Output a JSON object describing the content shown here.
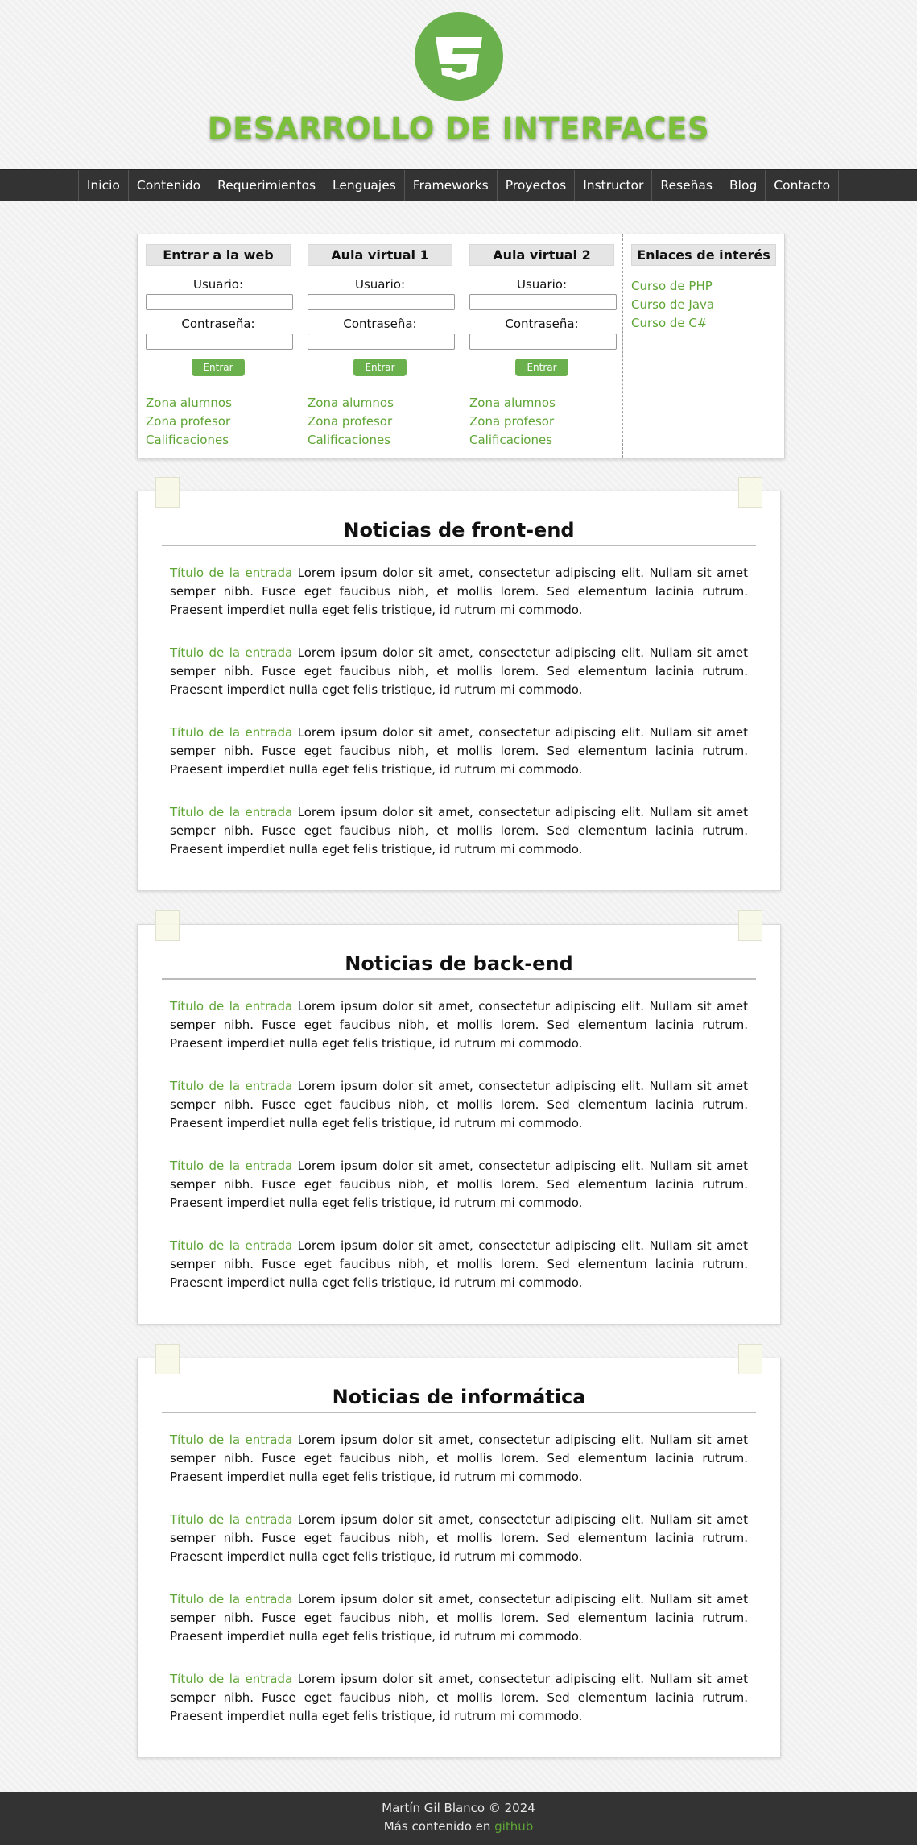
{
  "header": {
    "logo_icon": "css3-shield-icon",
    "title": "DESARROLLO DE INTERFACES",
    "accent_color": "#6ab04c"
  },
  "nav": {
    "items": [
      {
        "label": "Inicio"
      },
      {
        "label": "Contenido"
      },
      {
        "label": "Requerimientos"
      },
      {
        "label": "Lenguajes"
      },
      {
        "label": "Frameworks"
      },
      {
        "label": "Proyectos"
      },
      {
        "label": "Instructor"
      },
      {
        "label": "Reseñas"
      },
      {
        "label": "Blog"
      },
      {
        "label": "Contacto"
      }
    ]
  },
  "login": {
    "columns": [
      {
        "title": "Entrar a la web",
        "user_label": "Usuario:",
        "pass_label": "Contraseña:",
        "button": "Entrar",
        "links": [
          "Zona alumnos",
          "Zona profesor",
          "Calificaciones"
        ]
      },
      {
        "title": "Aula virtual 1",
        "user_label": "Usuario:",
        "pass_label": "Contraseña:",
        "button": "Entrar",
        "links": [
          "Zona alumnos",
          "Zona profesor",
          "Calificaciones"
        ]
      },
      {
        "title": "Aula virtual 2",
        "user_label": "Usuario:",
        "pass_label": "Contraseña:",
        "button": "Entrar",
        "links": [
          "Zona alumnos",
          "Zona profesor",
          "Calificaciones"
        ]
      }
    ],
    "interest": {
      "title": "Enlaces de interés",
      "links": [
        "Curso de PHP",
        "Curso de Java",
        "Curso de C#"
      ]
    }
  },
  "news": [
    {
      "title": "Noticias de front-end",
      "entries": [
        {
          "link": "Título de la entrada",
          "text": " Lorem ipsum dolor sit amet, consectetur adipiscing elit. Nullam sit amet semper nibh. Fusce eget faucibus nibh, et mollis lorem. Sed elementum lacinia rutrum. Praesent imperdiet nulla eget felis tristique, id rutrum mi commodo."
        },
        {
          "link": "Título de la entrada",
          "text": " Lorem ipsum dolor sit amet, consectetur adipiscing elit. Nullam sit amet semper nibh. Fusce eget faucibus nibh, et mollis lorem. Sed elementum lacinia rutrum. Praesent imperdiet nulla eget felis tristique, id rutrum mi commodo."
        },
        {
          "link": "Título de la entrada",
          "text": " Lorem ipsum dolor sit amet, consectetur adipiscing elit. Nullam sit amet semper nibh. Fusce eget faucibus nibh, et mollis lorem. Sed elementum lacinia rutrum. Praesent imperdiet nulla eget felis tristique, id rutrum mi commodo."
        },
        {
          "link": "Título de la entrada",
          "text": " Lorem ipsum dolor sit amet, consectetur adipiscing elit. Nullam sit amet semper nibh. Fusce eget faucibus nibh, et mollis lorem. Sed elementum lacinia rutrum. Praesent imperdiet nulla eget felis tristique, id rutrum mi commodo."
        }
      ]
    },
    {
      "title": "Noticias de back-end",
      "entries": [
        {
          "link": "Título de la entrada",
          "text": " Lorem ipsum dolor sit amet, consectetur adipiscing elit. Nullam sit amet semper nibh. Fusce eget faucibus nibh, et mollis lorem. Sed elementum lacinia rutrum. Praesent imperdiet nulla eget felis tristique, id rutrum mi commodo."
        },
        {
          "link": "Título de la entrada",
          "text": " Lorem ipsum dolor sit amet, consectetur adipiscing elit. Nullam sit amet semper nibh. Fusce eget faucibus nibh, et mollis lorem. Sed elementum lacinia rutrum. Praesent imperdiet nulla eget felis tristique, id rutrum mi commodo."
        },
        {
          "link": "Título de la entrada",
          "text": " Lorem ipsum dolor sit amet, consectetur adipiscing elit. Nullam sit amet semper nibh. Fusce eget faucibus nibh, et mollis lorem. Sed elementum lacinia rutrum. Praesent imperdiet nulla eget felis tristique, id rutrum mi commodo."
        },
        {
          "link": "Título de la entrada",
          "text": " Lorem ipsum dolor sit amet, consectetur adipiscing elit. Nullam sit amet semper nibh. Fusce eget faucibus nibh, et mollis lorem. Sed elementum lacinia rutrum. Praesent imperdiet nulla eget felis tristique, id rutrum mi commodo."
        }
      ]
    },
    {
      "title": "Noticias de informática",
      "entries": [
        {
          "link": "Título de la entrada",
          "text": " Lorem ipsum dolor sit amet, consectetur adipiscing elit. Nullam sit amet semper nibh. Fusce eget faucibus nibh, et mollis lorem. Sed elementum lacinia rutrum. Praesent imperdiet nulla eget felis tristique, id rutrum mi commodo."
        },
        {
          "link": "Título de la entrada",
          "text": " Lorem ipsum dolor sit amet, consectetur adipiscing elit. Nullam sit amet semper nibh. Fusce eget faucibus nibh, et mollis lorem. Sed elementum lacinia rutrum. Praesent imperdiet nulla eget felis tristique, id rutrum mi commodo."
        },
        {
          "link": "Título de la entrada",
          "text": " Lorem ipsum dolor sit amet, consectetur adipiscing elit. Nullam sit amet semper nibh. Fusce eget faucibus nibh, et mollis lorem. Sed elementum lacinia rutrum. Praesent imperdiet nulla eget felis tristique, id rutrum mi commodo."
        },
        {
          "link": "Título de la entrada",
          "text": " Lorem ipsum dolor sit amet, consectetur adipiscing elit. Nullam sit amet semper nibh. Fusce eget faucibus nibh, et mollis lorem. Sed elementum lacinia rutrum. Praesent imperdiet nulla eget felis tristique, id rutrum mi commodo."
        }
      ]
    }
  ],
  "footer": {
    "credit": "Martín Gil Blanco © 2024",
    "more_prefix": "Más contenido en ",
    "more_link": "github"
  }
}
